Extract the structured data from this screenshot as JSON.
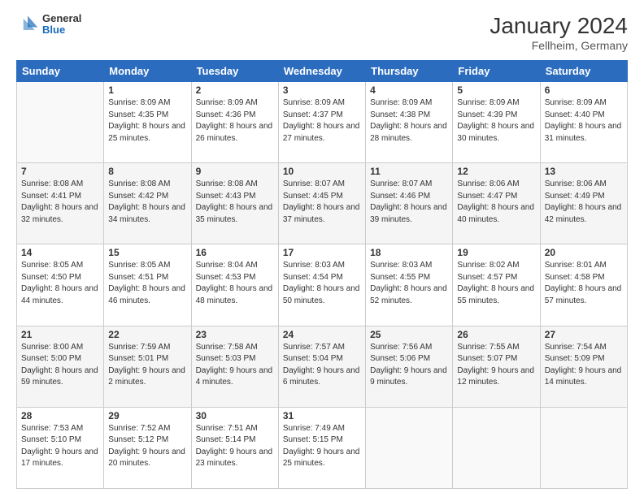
{
  "header": {
    "logo": {
      "general": "General",
      "blue": "Blue"
    },
    "title": "January 2024",
    "location": "Fellheim, Germany"
  },
  "days_of_week": [
    "Sunday",
    "Monday",
    "Tuesday",
    "Wednesday",
    "Thursday",
    "Friday",
    "Saturday"
  ],
  "weeks": [
    [
      {
        "day": "",
        "empty": true
      },
      {
        "day": "1",
        "sunrise": "Sunrise: 8:09 AM",
        "sunset": "Sunset: 4:35 PM",
        "daylight": "Daylight: 8 hours and 25 minutes."
      },
      {
        "day": "2",
        "sunrise": "Sunrise: 8:09 AM",
        "sunset": "Sunset: 4:36 PM",
        "daylight": "Daylight: 8 hours and 26 minutes."
      },
      {
        "day": "3",
        "sunrise": "Sunrise: 8:09 AM",
        "sunset": "Sunset: 4:37 PM",
        "daylight": "Daylight: 8 hours and 27 minutes."
      },
      {
        "day": "4",
        "sunrise": "Sunrise: 8:09 AM",
        "sunset": "Sunset: 4:38 PM",
        "daylight": "Daylight: 8 hours and 28 minutes."
      },
      {
        "day": "5",
        "sunrise": "Sunrise: 8:09 AM",
        "sunset": "Sunset: 4:39 PM",
        "daylight": "Daylight: 8 hours and 30 minutes."
      },
      {
        "day": "6",
        "sunrise": "Sunrise: 8:09 AM",
        "sunset": "Sunset: 4:40 PM",
        "daylight": "Daylight: 8 hours and 31 minutes."
      }
    ],
    [
      {
        "day": "7",
        "sunrise": "Sunrise: 8:08 AM",
        "sunset": "Sunset: 4:41 PM",
        "daylight": "Daylight: 8 hours and 32 minutes."
      },
      {
        "day": "8",
        "sunrise": "Sunrise: 8:08 AM",
        "sunset": "Sunset: 4:42 PM",
        "daylight": "Daylight: 8 hours and 34 minutes."
      },
      {
        "day": "9",
        "sunrise": "Sunrise: 8:08 AM",
        "sunset": "Sunset: 4:43 PM",
        "daylight": "Daylight: 8 hours and 35 minutes."
      },
      {
        "day": "10",
        "sunrise": "Sunrise: 8:07 AM",
        "sunset": "Sunset: 4:45 PM",
        "daylight": "Daylight: 8 hours and 37 minutes."
      },
      {
        "day": "11",
        "sunrise": "Sunrise: 8:07 AM",
        "sunset": "Sunset: 4:46 PM",
        "daylight": "Daylight: 8 hours and 39 minutes."
      },
      {
        "day": "12",
        "sunrise": "Sunrise: 8:06 AM",
        "sunset": "Sunset: 4:47 PM",
        "daylight": "Daylight: 8 hours and 40 minutes."
      },
      {
        "day": "13",
        "sunrise": "Sunrise: 8:06 AM",
        "sunset": "Sunset: 4:49 PM",
        "daylight": "Daylight: 8 hours and 42 minutes."
      }
    ],
    [
      {
        "day": "14",
        "sunrise": "Sunrise: 8:05 AM",
        "sunset": "Sunset: 4:50 PM",
        "daylight": "Daylight: 8 hours and 44 minutes."
      },
      {
        "day": "15",
        "sunrise": "Sunrise: 8:05 AM",
        "sunset": "Sunset: 4:51 PM",
        "daylight": "Daylight: 8 hours and 46 minutes."
      },
      {
        "day": "16",
        "sunrise": "Sunrise: 8:04 AM",
        "sunset": "Sunset: 4:53 PM",
        "daylight": "Daylight: 8 hours and 48 minutes."
      },
      {
        "day": "17",
        "sunrise": "Sunrise: 8:03 AM",
        "sunset": "Sunset: 4:54 PM",
        "daylight": "Daylight: 8 hours and 50 minutes."
      },
      {
        "day": "18",
        "sunrise": "Sunrise: 8:03 AM",
        "sunset": "Sunset: 4:55 PM",
        "daylight": "Daylight: 8 hours and 52 minutes."
      },
      {
        "day": "19",
        "sunrise": "Sunrise: 8:02 AM",
        "sunset": "Sunset: 4:57 PM",
        "daylight": "Daylight: 8 hours and 55 minutes."
      },
      {
        "day": "20",
        "sunrise": "Sunrise: 8:01 AM",
        "sunset": "Sunset: 4:58 PM",
        "daylight": "Daylight: 8 hours and 57 minutes."
      }
    ],
    [
      {
        "day": "21",
        "sunrise": "Sunrise: 8:00 AM",
        "sunset": "Sunset: 5:00 PM",
        "daylight": "Daylight: 8 hours and 59 minutes."
      },
      {
        "day": "22",
        "sunrise": "Sunrise: 7:59 AM",
        "sunset": "Sunset: 5:01 PM",
        "daylight": "Daylight: 9 hours and 2 minutes."
      },
      {
        "day": "23",
        "sunrise": "Sunrise: 7:58 AM",
        "sunset": "Sunset: 5:03 PM",
        "daylight": "Daylight: 9 hours and 4 minutes."
      },
      {
        "day": "24",
        "sunrise": "Sunrise: 7:57 AM",
        "sunset": "Sunset: 5:04 PM",
        "daylight": "Daylight: 9 hours and 6 minutes."
      },
      {
        "day": "25",
        "sunrise": "Sunrise: 7:56 AM",
        "sunset": "Sunset: 5:06 PM",
        "daylight": "Daylight: 9 hours and 9 minutes."
      },
      {
        "day": "26",
        "sunrise": "Sunrise: 7:55 AM",
        "sunset": "Sunset: 5:07 PM",
        "daylight": "Daylight: 9 hours and 12 minutes."
      },
      {
        "day": "27",
        "sunrise": "Sunrise: 7:54 AM",
        "sunset": "Sunset: 5:09 PM",
        "daylight": "Daylight: 9 hours and 14 minutes."
      }
    ],
    [
      {
        "day": "28",
        "sunrise": "Sunrise: 7:53 AM",
        "sunset": "Sunset: 5:10 PM",
        "daylight": "Daylight: 9 hours and 17 minutes."
      },
      {
        "day": "29",
        "sunrise": "Sunrise: 7:52 AM",
        "sunset": "Sunset: 5:12 PM",
        "daylight": "Daylight: 9 hours and 20 minutes."
      },
      {
        "day": "30",
        "sunrise": "Sunrise: 7:51 AM",
        "sunset": "Sunset: 5:14 PM",
        "daylight": "Daylight: 9 hours and 23 minutes."
      },
      {
        "day": "31",
        "sunrise": "Sunrise: 7:49 AM",
        "sunset": "Sunset: 5:15 PM",
        "daylight": "Daylight: 9 hours and 25 minutes."
      },
      {
        "day": "",
        "empty": true
      },
      {
        "day": "",
        "empty": true
      },
      {
        "day": "",
        "empty": true
      }
    ]
  ]
}
